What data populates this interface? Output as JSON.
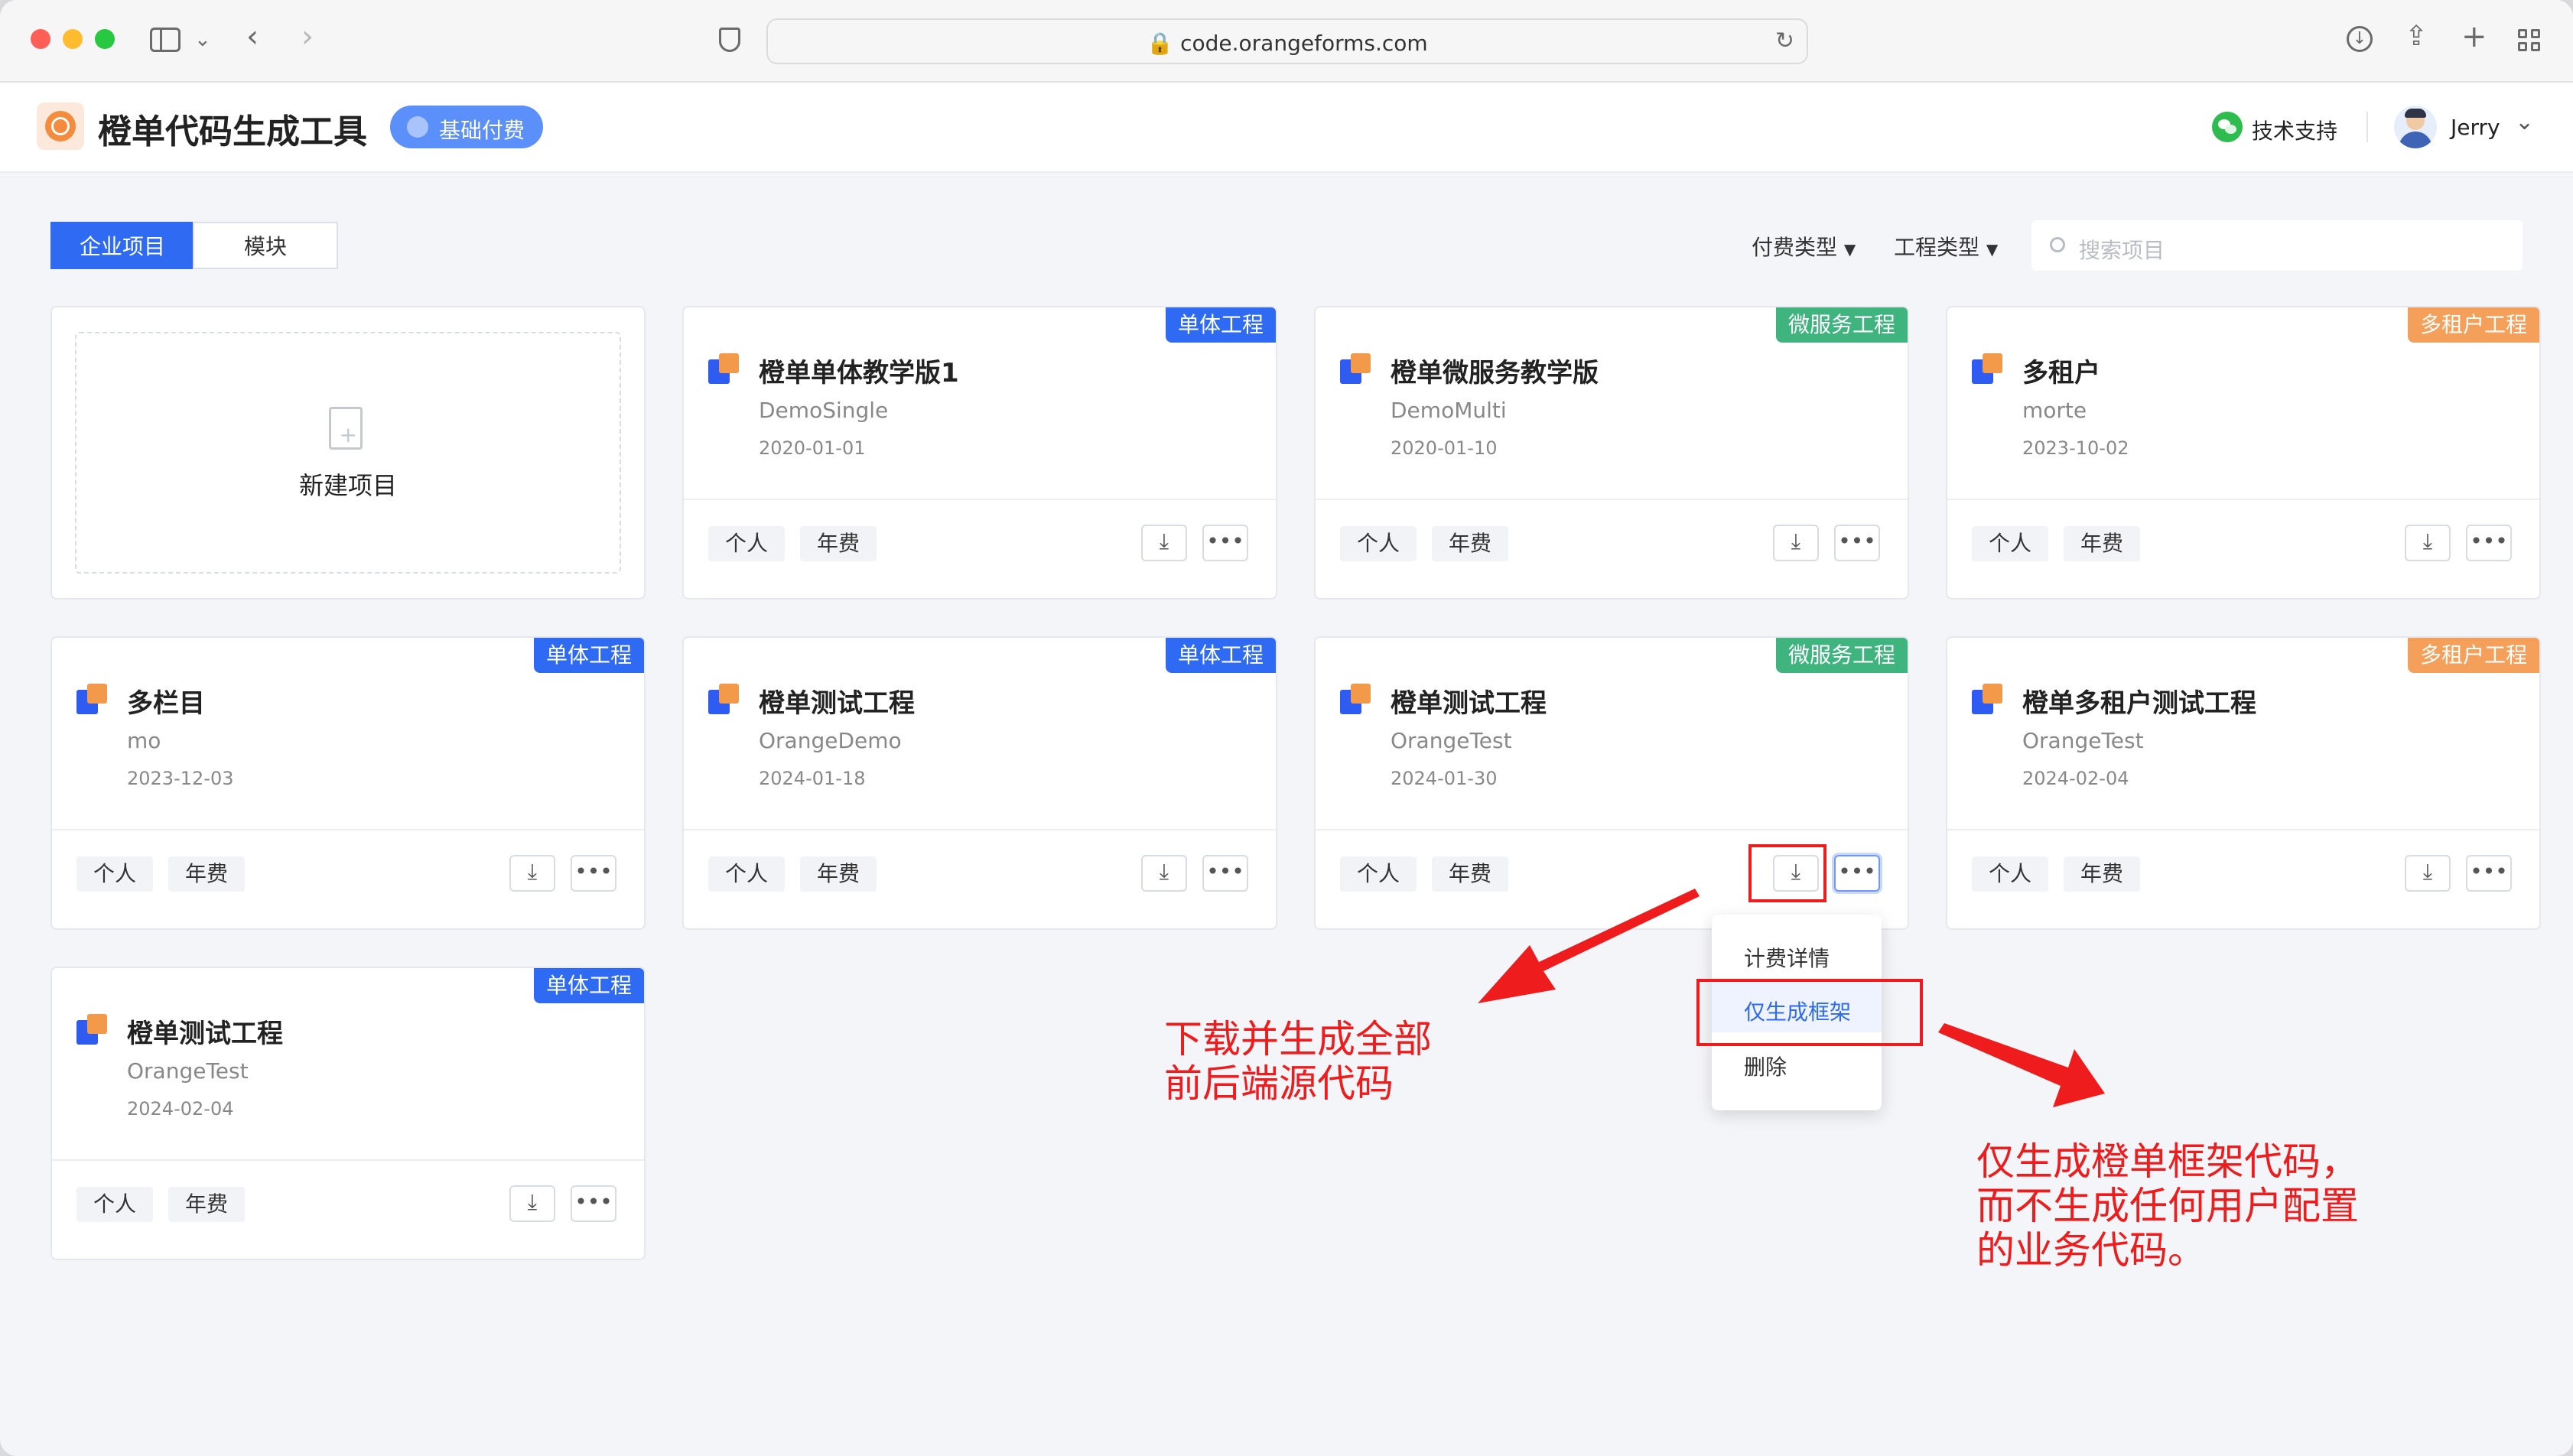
{
  "browser": {
    "url": "code.orangeforms.com"
  },
  "header": {
    "title": "橙单代码生成工具",
    "badge": "基础付费",
    "support": "技术支持",
    "user": "Jerry"
  },
  "toolbar": {
    "tabs": [
      {
        "label": "企业项目",
        "active": true
      },
      {
        "label": "模块",
        "active": false
      }
    ],
    "filters": [
      "付费类型",
      "工程类型"
    ],
    "search_placeholder": "搜索项目"
  },
  "new_project": {
    "label": "新建项目"
  },
  "projects": [
    {
      "name": "橙单单体教学版1",
      "code": "DemoSingle",
      "date": "2020-01-01",
      "tag": "单体工程",
      "tag_color": "#2f6bf2",
      "chips": [
        "个人",
        "年费"
      ]
    },
    {
      "name": "橙单微服务教学版",
      "code": "DemoMulti",
      "date": "2020-01-10",
      "tag": "微服务工程",
      "tag_color": "#3fb47f",
      "chips": [
        "个人",
        "年费"
      ]
    },
    {
      "name": "多租户",
      "code": "morte",
      "date": "2023-10-02",
      "tag": "多租户工程",
      "tag_color": "#f5a05a",
      "chips": [
        "个人",
        "年费"
      ]
    },
    {
      "name": "多栏目",
      "code": "mo",
      "date": "2023-12-03",
      "tag": "单体工程",
      "tag_color": "#2f6bf2",
      "chips": [
        "个人",
        "年费"
      ]
    },
    {
      "name": "橙单测试工程",
      "code": "OrangeDemo",
      "date": "2024-01-18",
      "tag": "单体工程",
      "tag_color": "#2f6bf2",
      "chips": [
        "个人",
        "年费"
      ]
    },
    {
      "name": "橙单测试工程",
      "code": "OrangeTest",
      "date": "2024-01-30",
      "tag": "微服务工程",
      "tag_color": "#3fb47f",
      "chips": [
        "个人",
        "年费"
      ]
    },
    {
      "name": "橙单多租户测试工程",
      "code": "OrangeTest",
      "date": "2024-02-04",
      "tag": "多租户工程",
      "tag_color": "#f5a05a",
      "chips": [
        "个人",
        "年费"
      ]
    },
    {
      "name": "橙单测试工程",
      "code": "OrangeTest",
      "date": "2024-02-04",
      "tag": "单体工程",
      "tag_color": "#2f6bf2",
      "chips": [
        "个人",
        "年费"
      ]
    }
  ],
  "dropdown": {
    "items": [
      "计费详情",
      "仅生成框架",
      "删除"
    ],
    "highlighted": "仅生成框架"
  },
  "annotations": {
    "left_note": [
      "下载并生成全部",
      "前后端源代码"
    ],
    "right_note": [
      "仅生成橙单框架代码，",
      "而不生成任何用户配置",
      "的业务代码。"
    ]
  },
  "icons": {
    "download": "download-icon",
    "more": "more-icon",
    "file_add": "file-add-icon"
  }
}
